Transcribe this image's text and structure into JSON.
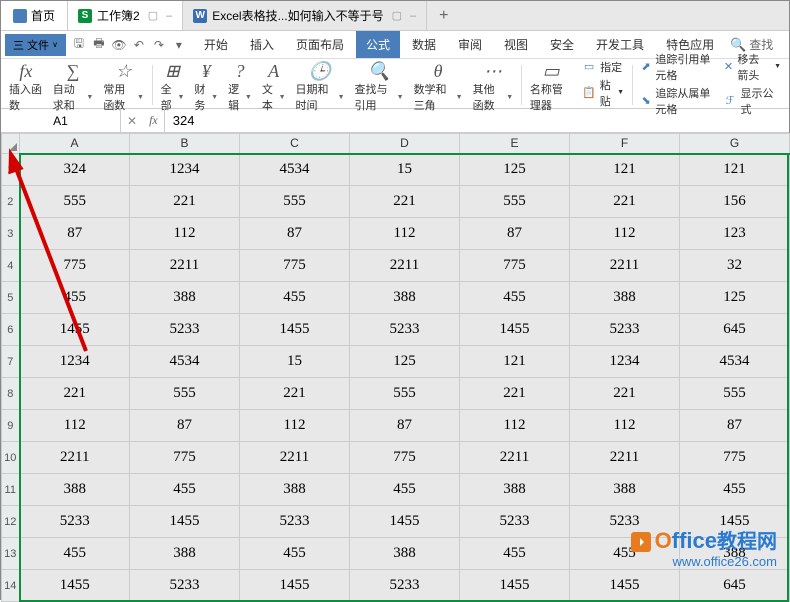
{
  "tabs": {
    "home": "首页",
    "doc1": "工作簿2",
    "doc2": "Excel表格技...如何输入不等于号"
  },
  "menu": {
    "file": "三 文件"
  },
  "ribbon": [
    "开始",
    "插入",
    "页面布局",
    "公式",
    "数据",
    "审阅",
    "视图",
    "安全",
    "开发工具",
    "特色应用"
  ],
  "search": "查找",
  "tools": {
    "insert_fn": "插入函数",
    "autosum": "自动求和",
    "common": "常用函数",
    "all": "全部",
    "finance": "财务",
    "logic": "逻辑",
    "text": "文本",
    "datetime": "日期和时间",
    "lookup": "查找与引用",
    "math": "数学和三角",
    "other": "其他函数",
    "name_mgr": "名称管理器",
    "paste": "粘贴",
    "ref_box": "指定",
    "trace_prec": "追踪引用单元格",
    "trace_dep": "追踪从属单元格",
    "move_front": "移去箭头",
    "show_formula": "显示公式"
  },
  "cellref": "A1",
  "formula": "324",
  "columns": [
    "A",
    "B",
    "C",
    "D",
    "E",
    "F",
    "G"
  ],
  "rows": [
    [
      "324",
      "1234",
      "4534",
      "15",
      "125",
      "121",
      "121"
    ],
    [
      "555",
      "221",
      "555",
      "221",
      "555",
      "221",
      "156"
    ],
    [
      "87",
      "112",
      "87",
      "112",
      "87",
      "112",
      "123"
    ],
    [
      "775",
      "2211",
      "775",
      "2211",
      "775",
      "2211",
      "32"
    ],
    [
      "455",
      "388",
      "455",
      "388",
      "455",
      "388",
      "125"
    ],
    [
      "1455",
      "5233",
      "1455",
      "5233",
      "1455",
      "5233",
      "645"
    ],
    [
      "1234",
      "4534",
      "15",
      "125",
      "121",
      "1234",
      "4534"
    ],
    [
      "221",
      "555",
      "221",
      "555",
      "221",
      "221",
      "555"
    ],
    [
      "112",
      "87",
      "112",
      "87",
      "112",
      "112",
      "87"
    ],
    [
      "2211",
      "775",
      "2211",
      "775",
      "2211",
      "2211",
      "775"
    ],
    [
      "388",
      "455",
      "388",
      "455",
      "388",
      "388",
      "455"
    ],
    [
      "5233",
      "1455",
      "5233",
      "1455",
      "5233",
      "5233",
      "1455"
    ],
    [
      "455",
      "388",
      "455",
      "388",
      "455",
      "455",
      "388"
    ],
    [
      "1455",
      "5233",
      "1455",
      "5233",
      "1455",
      "1455",
      "645"
    ]
  ],
  "watermark": {
    "brand1": "O",
    "brand2": "ffice",
    "brand3": "教程网",
    "url": "www.office26.com"
  }
}
